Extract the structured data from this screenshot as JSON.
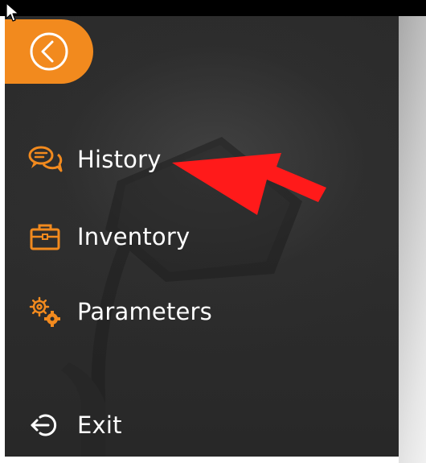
{
  "colors": {
    "accent": "#f28a1e",
    "panel_bg": "#2b2b2b",
    "text": "#ffffff",
    "annotation": "#ff1a1a"
  },
  "back_button": {
    "icon": "chevron-left-circle-icon"
  },
  "menu": {
    "items": [
      {
        "label": "History",
        "icon": "chat-bubbles-icon"
      },
      {
        "label": "Inventory",
        "icon": "briefcase-icon"
      },
      {
        "label": "Parameters",
        "icon": "gears-icon"
      }
    ],
    "exit": {
      "label": "Exit",
      "icon": "logout-icon"
    }
  },
  "annotation": {
    "type": "red-arrow",
    "points_to": "History"
  }
}
